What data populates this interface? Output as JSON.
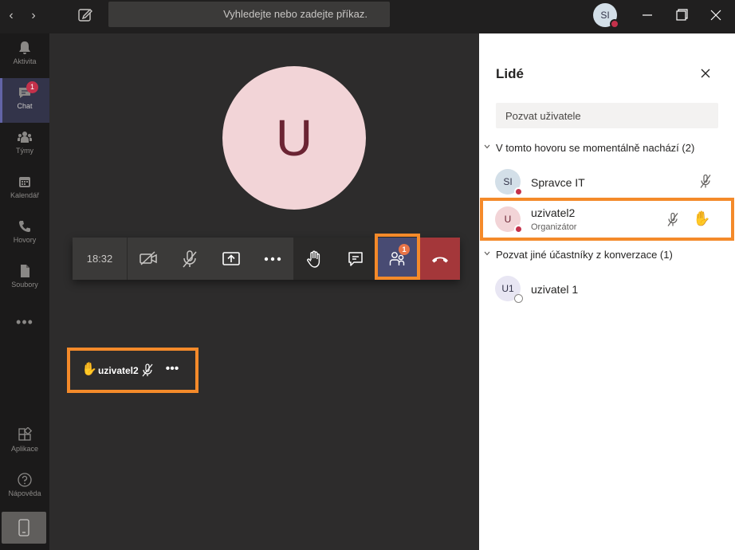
{
  "topbar": {
    "search_placeholder": "Vyhledejte nebo zadejte příkaz.",
    "user_initials": "SI"
  },
  "rail": {
    "items": [
      {
        "label": "Aktivita",
        "icon": "bell-icon"
      },
      {
        "label": "Chat",
        "icon": "chat-icon",
        "badge": "1"
      },
      {
        "label": "Týmy",
        "icon": "teams-icon"
      },
      {
        "label": "Kalendář",
        "icon": "calendar-icon"
      },
      {
        "label": "Hovory",
        "icon": "phone-icon"
      },
      {
        "label": "Soubory",
        "icon": "files-icon"
      },
      {
        "label": "Aplikace",
        "icon": "apps-icon"
      },
      {
        "label": "Nápověda",
        "icon": "help-icon"
      }
    ],
    "more": "•••"
  },
  "stage": {
    "avatar_initial": "U"
  },
  "callbar": {
    "timer": "18:32",
    "participants_badge": "1"
  },
  "participant_tile": {
    "name": "uzivatel2",
    "more": "•••",
    "hand": "✋"
  },
  "panel": {
    "title": "Lidé",
    "invite_placeholder": "Pozvat uživatele",
    "section_in_call": "V tomto hovoru se momentálně nachází (2)",
    "section_invite": "Pozvat jiné účastníky z konverzace (1)",
    "people": [
      {
        "initials": "SI",
        "name": "Spravce IT",
        "role": "",
        "avatar_bg": "#d3dfe8",
        "avatar_fg": "#33344a"
      },
      {
        "initials": "U",
        "name": "uzivatel2",
        "role": "Organizátor",
        "avatar_bg": "#f2d4d7",
        "avatar_fg": "#6b2433",
        "hand": "✋"
      },
      {
        "initials": "U1",
        "name": "uzivatel 1",
        "role": "",
        "avatar_bg": "#e8e6f3",
        "avatar_fg": "#33344a"
      }
    ]
  },
  "colors": {
    "accent": "#6264a7",
    "highlight": "#f48a2a",
    "leave": "#a4373a",
    "busy": "#c4314b"
  }
}
